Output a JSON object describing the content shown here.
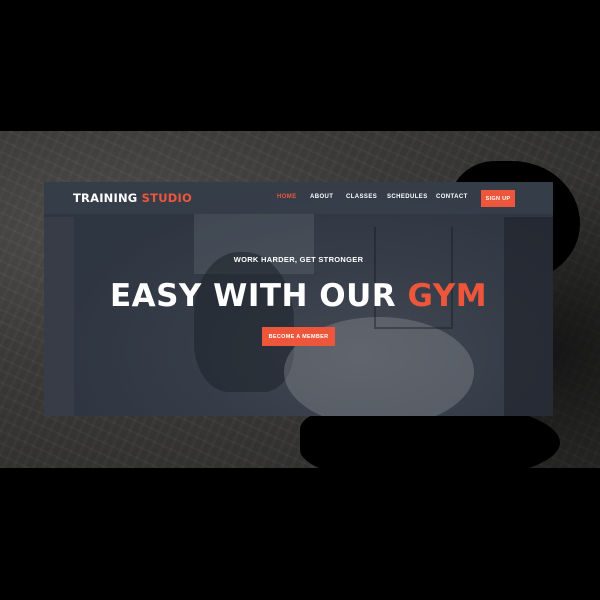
{
  "brand": {
    "name_part1": "TRAINING",
    "name_part2": "STUDIO"
  },
  "nav": {
    "items": [
      {
        "label": "HOME",
        "active": true
      },
      {
        "label": "ABOUT",
        "active": false
      },
      {
        "label": "CLASSES",
        "active": false
      },
      {
        "label": "SCHEDULES",
        "active": false
      },
      {
        "label": "CONTACT",
        "active": false
      }
    ],
    "signup_label": "SIGN UP"
  },
  "hero": {
    "tagline": "WORK HARDER, GET STRONGER",
    "headline_part1": "EASY WITH OUR",
    "headline_part2": "GYM",
    "cta_label": "BECOME A MEMBER"
  },
  "colors": {
    "accent": "#ed563b",
    "overlay": "#2c3440",
    "text": "#ffffff"
  }
}
